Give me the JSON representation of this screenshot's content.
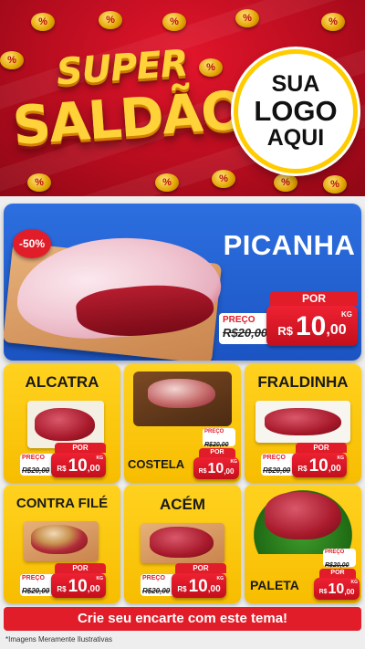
{
  "header": {
    "title_line1": "SUPER",
    "title_line2": "SALDÃO",
    "logo_line1": "SUA",
    "logo_line2": "LOGO",
    "logo_line3": "AQUI",
    "coin_glyph": "%"
  },
  "hero": {
    "discount": "-50%",
    "name": "PICANHA",
    "preco_label": "PREÇO",
    "old_price": "R$20,00",
    "por_label": "POR",
    "currency": "R$",
    "price_int": "10",
    "price_dec": ",00",
    "unit": "KG"
  },
  "products": [
    {
      "name": "ALCATRA",
      "preco_label": "PREÇO",
      "old_price": "R$20,00",
      "por_label": "POR",
      "currency": "R$",
      "price_int": "10",
      "price_dec": ",00",
      "unit": "KG"
    },
    {
      "name": "COSTELA",
      "preco_label": "PREÇO",
      "old_price": "R$20,00",
      "por_label": "POR",
      "currency": "R$",
      "price_int": "10",
      "price_dec": ",00",
      "unit": "KG"
    },
    {
      "name": "FRALDINHA",
      "preco_label": "PREÇO",
      "old_price": "R$20,00",
      "por_label": "POR",
      "currency": "R$",
      "price_int": "10",
      "price_dec": ",00",
      "unit": "KG"
    },
    {
      "name": "CONTRA FILÉ",
      "preco_label": "PREÇO",
      "old_price": "R$20,00",
      "por_label": "POR",
      "currency": "R$",
      "price_int": "10",
      "price_dec": ",00",
      "unit": "KG"
    },
    {
      "name": "ACÉM",
      "preco_label": "PREÇO",
      "old_price": "R$20,00",
      "por_label": "POR",
      "currency": "R$",
      "price_int": "10",
      "price_dec": ",00",
      "unit": "KG"
    },
    {
      "name": "PALETA",
      "preco_label": "PREÇO",
      "old_price": "R$20,00",
      "por_label": "POR",
      "currency": "R$",
      "price_int": "10",
      "price_dec": ",00",
      "unit": "KG"
    }
  ],
  "cta": "Crie seu encarte com este tema!",
  "footnote": "*Imagens Meramente Ilustrativas",
  "colors": {
    "brand_red": "#e21d2a",
    "hero_blue": "#1b54c2",
    "card_yellow": "#ffd21f",
    "title_gold": "#ffd23a"
  }
}
